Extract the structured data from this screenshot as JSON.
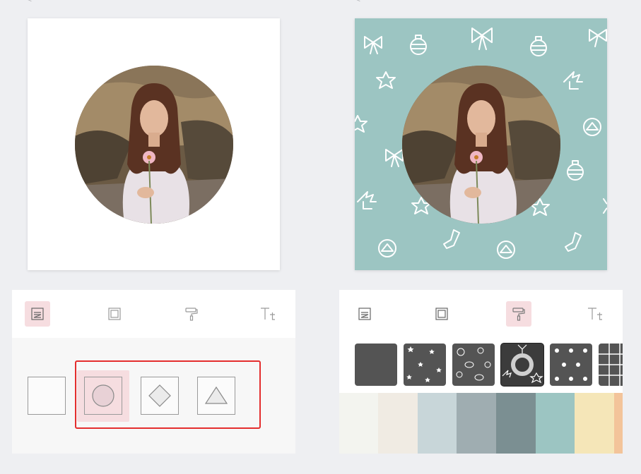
{
  "left": {
    "tools": [
      {
        "name": "background",
        "active": true
      },
      {
        "name": "frame",
        "active": false
      },
      {
        "name": "paint",
        "active": false
      },
      {
        "name": "text",
        "active": false
      }
    ],
    "shapes": [
      "square",
      "circle",
      "diamond",
      "triangle"
    ],
    "selected_shape": "circle"
  },
  "right": {
    "tools": [
      {
        "name": "background",
        "active": false
      },
      {
        "name": "frame",
        "active": false
      },
      {
        "name": "paint",
        "active": true
      },
      {
        "name": "text",
        "active": false
      }
    ],
    "patterns": [
      "solid",
      "stars",
      "ornaments",
      "christmas",
      "dots",
      "grid"
    ],
    "selected_pattern": "christmas",
    "swatches": [
      "#f3f4ef",
      "#f0ebe3",
      "#c8d6d9",
      "#9fadb1",
      "#7b8f92",
      "#9cc5c2",
      "#f5e6b8",
      "#f3c49a"
    ]
  },
  "colors": {
    "accent_pink": "#f6dde0",
    "highlight_red": "#e42d2d",
    "canvas_teal": "#9cc5c2"
  }
}
